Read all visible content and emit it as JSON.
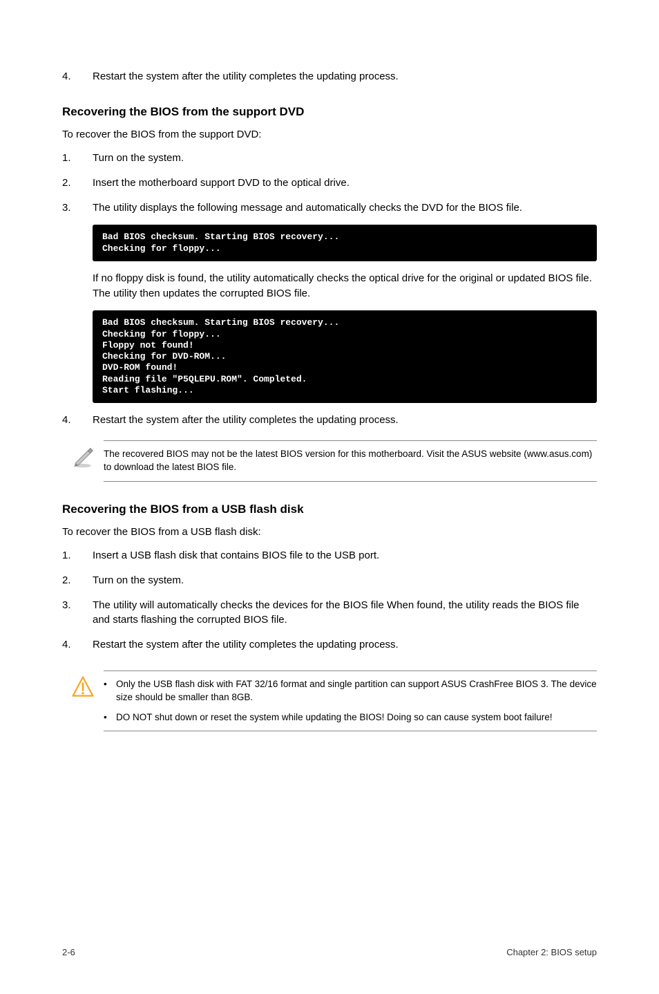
{
  "topStep": {
    "num": "4.",
    "text": "Restart the system after the utility completes the updating process."
  },
  "sectionA": {
    "heading": "Recovering the BIOS from the support DVD",
    "intro": "To recover the BIOS from the support DVD:",
    "steps": [
      {
        "num": "1.",
        "text": "Turn on the system."
      },
      {
        "num": "2.",
        "text": "Insert the motherboard support DVD to the optical drive."
      },
      {
        "num": "3.",
        "text": "The utility displays the following message and automatically checks the DVD for the BIOS file."
      }
    ],
    "terminal1": "Bad BIOS checksum. Starting BIOS recovery...\nChecking for floppy...",
    "midtext": "If no floppy disk is found, the utility automatically checks the optical drive for the original or updated BIOS file. The utility then updates the corrupted BIOS file.",
    "terminal2": "Bad BIOS checksum. Starting BIOS recovery...\nChecking for floppy...\nFloppy not found!\nChecking for DVD-ROM...\nDVD-ROM found!\nReading file \"P5QLEPU.ROM\". Completed.\nStart flashing...",
    "step4": {
      "num": "4.",
      "text": "Restart the system after the utility completes the updating process."
    },
    "note": "The recovered BIOS may not be the latest BIOS version for this motherboard. Visit the ASUS website (www.asus.com) to download the latest BIOS file."
  },
  "sectionB": {
    "heading": "Recovering the BIOS from a USB flash disk",
    "intro": "To recover the BIOS from a USB flash disk:",
    "steps": [
      {
        "num": "1.",
        "text": "Insert a USB flash disk that contains BIOS file to the USB port."
      },
      {
        "num": "2.",
        "text": "Turn on the system."
      },
      {
        "num": "3.",
        "text": "The utility will automatically checks the devices for the BIOS file When found, the utility reads the BIOS file and starts flashing the corrupted BIOS file."
      },
      {
        "num": "4.",
        "text": "Restart the system after the utility completes the updating process."
      }
    ],
    "warnings": [
      "Only the USB flash disk with FAT 32/16 format and single partition can support ASUS CrashFree BIOS 3. The device size should be smaller than 8GB.",
      "DO NOT shut down or reset the system while updating the BIOS! Doing so can cause system boot failure!"
    ]
  },
  "footer": {
    "left": "2-6",
    "right": "Chapter 2: BIOS setup"
  }
}
